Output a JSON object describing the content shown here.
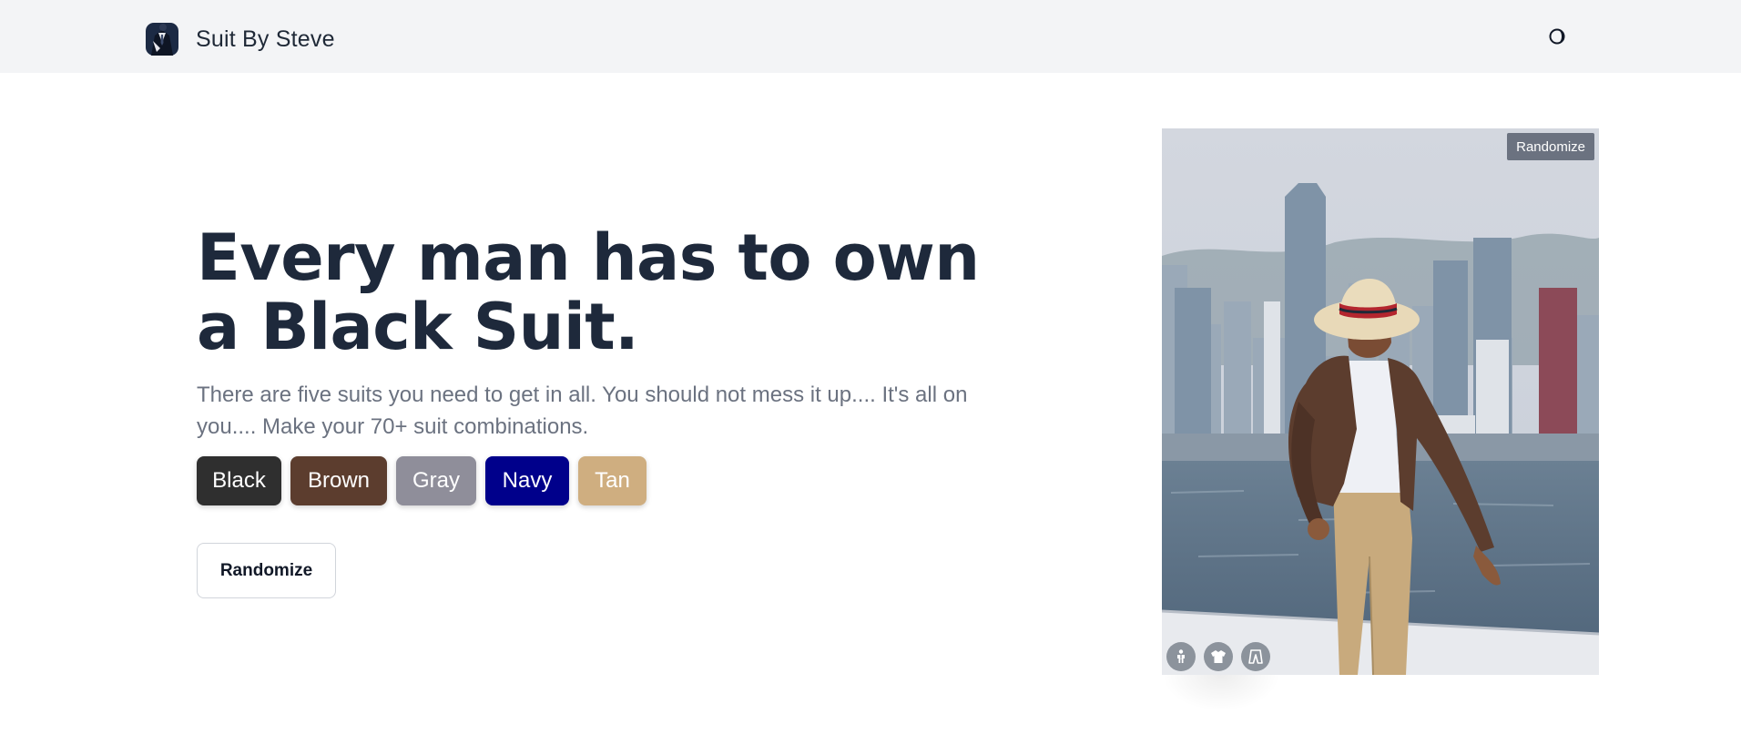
{
  "header": {
    "brand_name": "Suit By Steve",
    "logo_icon": "suit-logo-icon",
    "theme_toggle_icon": "half-moon-icon"
  },
  "hero": {
    "headline": "Every man has to own a Black Suit.",
    "description": "There are five suits you need to get in all. You should not mess it up.... It's all on you.... Make your 70+ suit combinations.",
    "randomize_label": "Randomize"
  },
  "colors": {
    "swatches": [
      {
        "label": "Black",
        "color": "#2f2f2f"
      },
      {
        "label": "Brown",
        "color": "#5c3d2e"
      },
      {
        "label": "Gray",
        "color": "#8f8e9a"
      },
      {
        "label": "Navy",
        "color": "#00008b"
      },
      {
        "label": "Tan",
        "color": "#cfae80"
      }
    ],
    "jacket": "#5c3d2e",
    "trousers": "#c8aa7d"
  },
  "preview": {
    "randomize_label": "Randomize",
    "layer_controls": [
      {
        "icon": "person-icon"
      },
      {
        "icon": "shirt-icon"
      },
      {
        "icon": "trousers-icon"
      }
    ]
  }
}
